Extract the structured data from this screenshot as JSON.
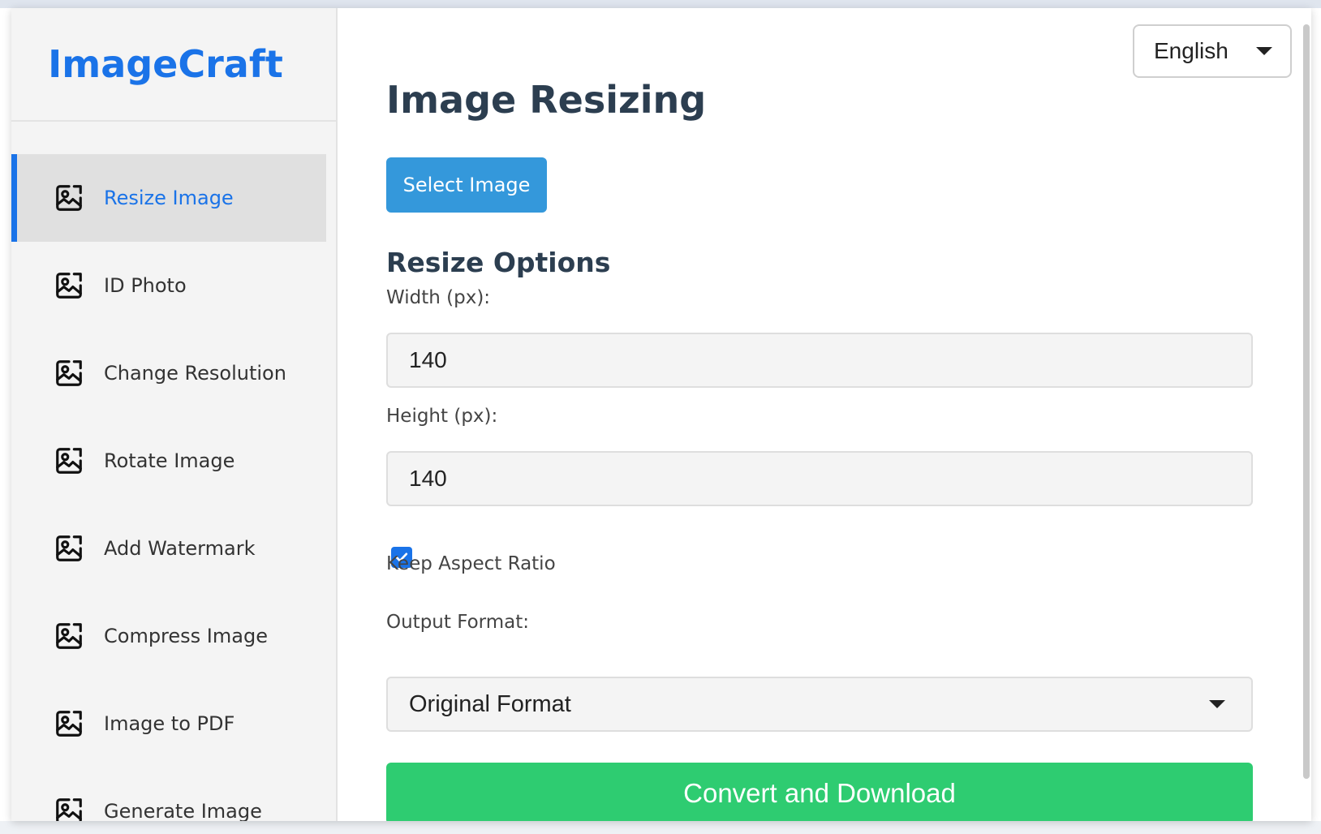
{
  "brand": {
    "name": "ImageCraft",
    "color": "#1a73e8"
  },
  "sidebar": {
    "items": [
      {
        "label": "Resize Image",
        "icon": "image-icon",
        "active": true
      },
      {
        "label": "ID Photo",
        "icon": "image-icon",
        "active": false
      },
      {
        "label": "Change Resolution",
        "icon": "image-icon",
        "active": false
      },
      {
        "label": "Rotate Image",
        "icon": "image-icon",
        "active": false
      },
      {
        "label": "Add Watermark",
        "icon": "image-icon",
        "active": false
      },
      {
        "label": "Compress Image",
        "icon": "image-icon",
        "active": false
      },
      {
        "label": "Image to PDF",
        "icon": "image-icon",
        "active": false
      },
      {
        "label": "Generate Image",
        "icon": "image-icon",
        "active": false
      }
    ]
  },
  "language": {
    "selected": "English"
  },
  "main": {
    "title": "Image Resizing",
    "select_button": "Select Image",
    "options_title": "Resize Options",
    "width": {
      "label": "Width (px):",
      "value": "140"
    },
    "height": {
      "label": "Height (px):",
      "value": "140"
    },
    "keep_aspect": {
      "label": "Keep Aspect Ratio",
      "checked": true
    },
    "output_format": {
      "label": "Output Format:",
      "selected": "Original Format"
    },
    "convert_button": "Convert and Download"
  },
  "colors": {
    "accent": "#1a73e8",
    "title": "#2c3e50",
    "select_button": "#3498db",
    "convert_button": "#2ecc71"
  }
}
